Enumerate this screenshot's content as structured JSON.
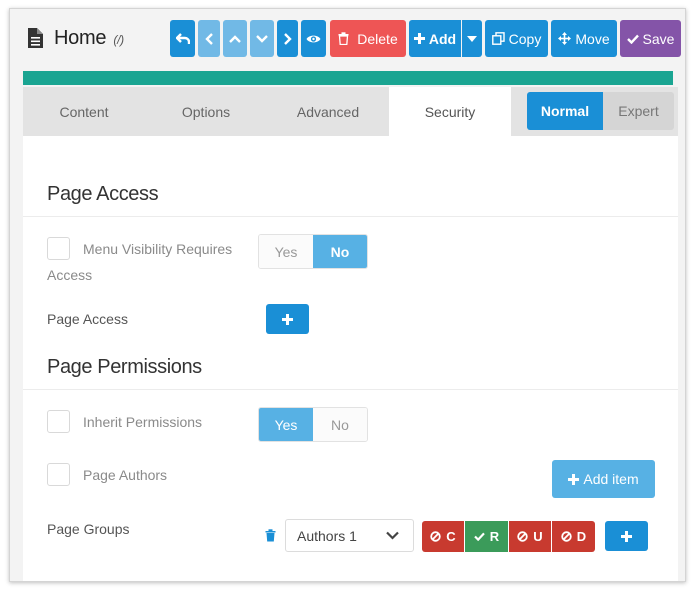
{
  "header": {
    "title": "Home",
    "path": "(/)",
    "buttons": {
      "delete": "Delete",
      "add": "Add",
      "copy": "Copy",
      "move": "Move",
      "save": "Save"
    }
  },
  "tabs": [
    {
      "label": "Content",
      "active": false
    },
    {
      "label": "Options",
      "active": false
    },
    {
      "label": "Advanced",
      "active": false
    },
    {
      "label": "Security",
      "active": true
    }
  ],
  "mode_toggle": {
    "normal": "Normal",
    "expert": "Expert",
    "selected": "Normal"
  },
  "page_access": {
    "title": "Page Access",
    "menu_visibility": {
      "label": "Menu Visibility Requires Access",
      "yes": "Yes",
      "no": "No",
      "selected": "No"
    },
    "access_label": "Page Access"
  },
  "page_permissions": {
    "title": "Page Permissions",
    "inherit": {
      "label": "Inherit Permissions",
      "yes": "Yes",
      "no": "No",
      "selected": "Yes"
    },
    "authors_label": "Page Authors",
    "add_item": "Add item",
    "groups_label": "Page Groups",
    "group_select": "Authors 1",
    "crud": [
      {
        "letter": "C",
        "state": "denied"
      },
      {
        "letter": "R",
        "state": "allowed"
      },
      {
        "letter": "U",
        "state": "denied"
      },
      {
        "letter": "D",
        "state": "denied"
      }
    ]
  },
  "colors": {
    "primary": "#1a8fd6",
    "primary_light": "#57b1e4",
    "danger": "#ee5555",
    "deny": "#c83a2f",
    "allow": "#3b9b5a",
    "save": "#8454a8",
    "accent_strip": "#1aa592"
  },
  "icons": [
    "document-icon",
    "undo-icon",
    "chevron-left-icon",
    "chevron-up-icon",
    "chevron-down-icon",
    "chevron-right-icon",
    "eye-icon",
    "trash-icon",
    "plus-icon",
    "caret-down-icon",
    "copy-icon",
    "move-icon",
    "check-icon",
    "ban-icon"
  ]
}
